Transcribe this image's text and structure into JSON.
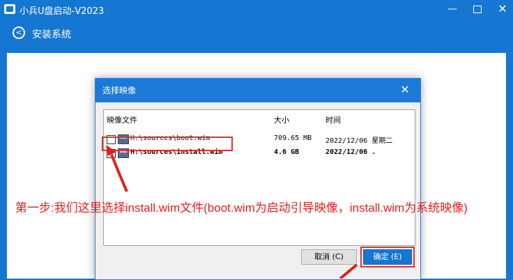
{
  "window": {
    "title": "小兵U盘启动-V2023",
    "minimize_glyph": "—",
    "close_glyph": "✕"
  },
  "section": {
    "back_glyph": "<",
    "title": "安装系统"
  },
  "dialog": {
    "title": "选择映像",
    "close_glyph": "✕",
    "columns": [
      "映像文件",
      "大小",
      "时间"
    ],
    "rows": [
      {
        "checked": false,
        "file": "H:\\sources\\boot.wim",
        "size": "709.65 MB",
        "time": "2022/12/06 星期二",
        "bold": false
      },
      {
        "checked": true,
        "file": "H:\\sources\\install.wim",
        "size": "4.6 GB",
        "time": "2022/12/06 .",
        "bold": true
      }
    ],
    "cancel_label": "取消 (C)",
    "ok_label": "确定 (E)"
  },
  "annotation": {
    "text": "第一步:我们这里选择install.wim文件(boot.wim为启动引导映像，install.wim为系统映像)",
    "color": "#e02020"
  },
  "colors": {
    "accent": "#1677d2",
    "highlight": "#e03030"
  }
}
